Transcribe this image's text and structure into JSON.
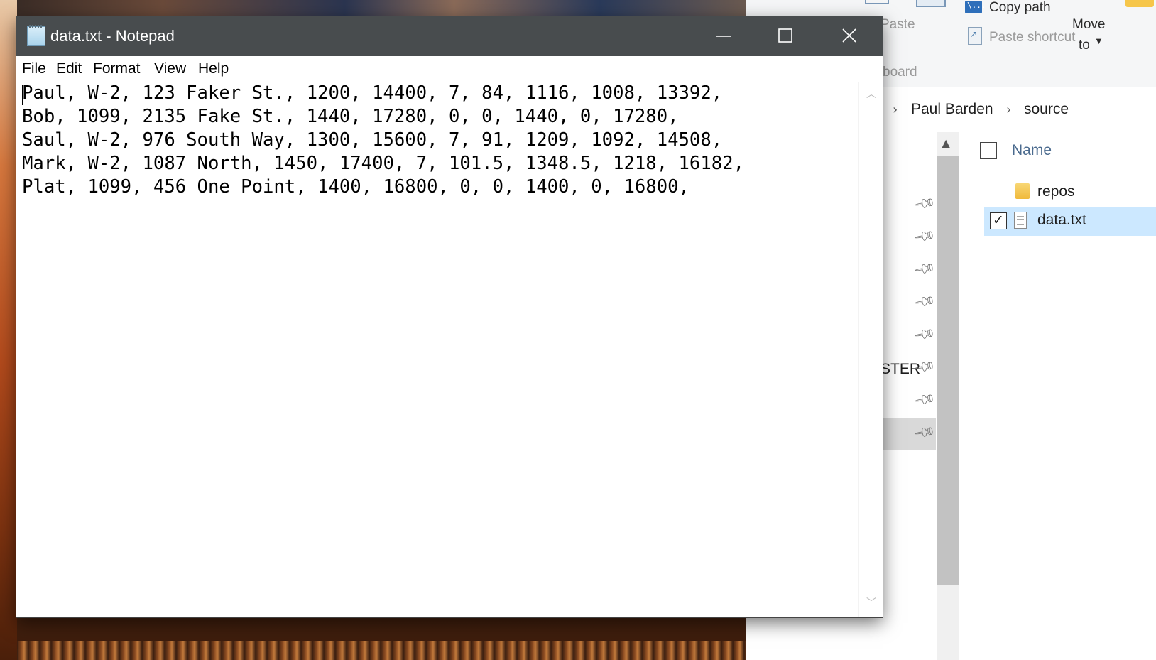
{
  "notepad": {
    "title": "data.txt - Notepad",
    "menu": [
      "File",
      "Edit",
      "Format",
      "View",
      "Help"
    ],
    "lines": [
      "Paul, W-2, 123 Faker St., 1200, 14400, 7, 84, 1116, 1008, 13392,",
      "Bob, 1099, 2135 Fake St., 1440, 17280, 0, 0, 1440, 0, 17280,",
      "Saul, W-2, 976 South Way, 1300, 15600, 7, 91, 1209, 1092, 14508,",
      "Mark, W-2, 1087 North, 1450, 17400, 7, 101.5, 1348.5, 1218, 16182,",
      "Plat, 1099, 456 One Point, 1400, 16800, 0, 0, 1400, 0, 16800,"
    ],
    "window_buttons": {
      "minimize": "minimize-icon",
      "maximize": "maximize-icon",
      "close": "close-icon"
    },
    "title_bar_color": "#484c4e"
  },
  "explorer": {
    "ribbon": {
      "paste_label": "Paste",
      "copy_path_label": "Copy path",
      "paste_shortcut_label": "Paste shortcut",
      "clipboard_label": "board",
      "move_to_label_line1": "Move",
      "move_to_label_line2": "to"
    },
    "breadcrumb": [
      "Paul Barden",
      "source"
    ],
    "nav_partial_label": "STER",
    "column_header": "Name",
    "files": [
      {
        "name": "repos",
        "icon": "folder-icon",
        "selected": false
      },
      {
        "name": "data.txt",
        "icon": "text-file-icon",
        "selected": true
      }
    ],
    "selection_color": "#cce8ff"
  }
}
